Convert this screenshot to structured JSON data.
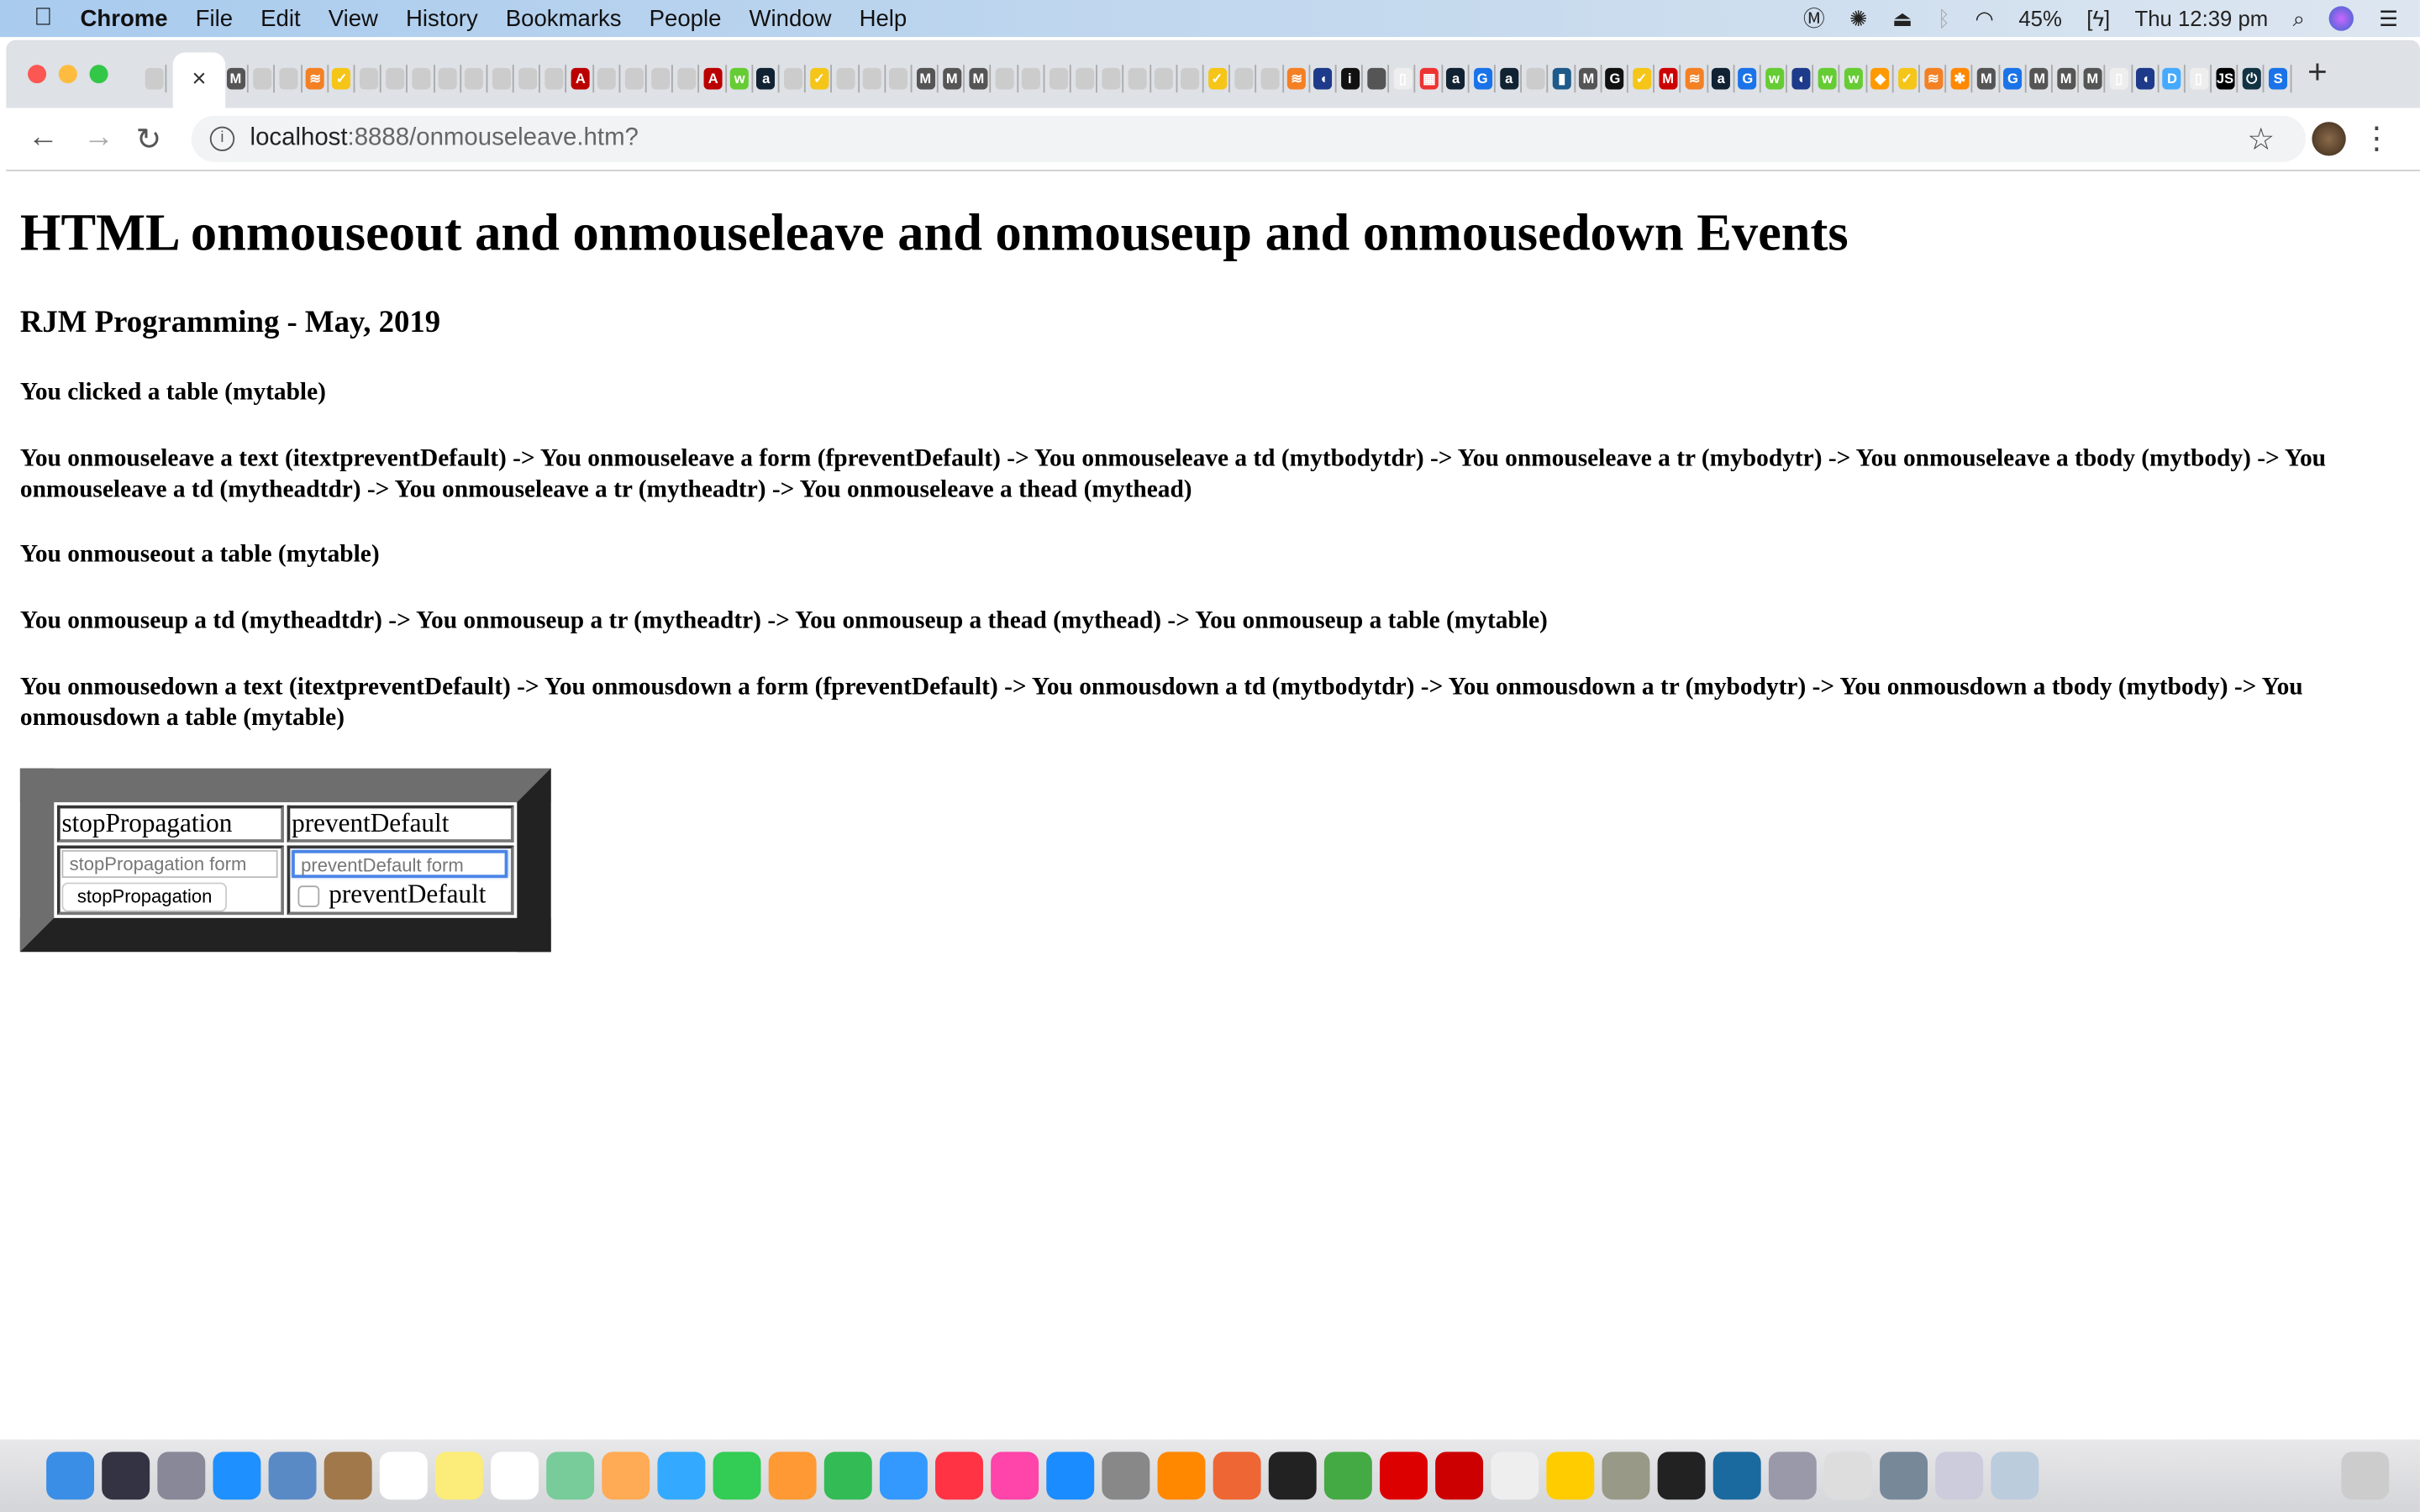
{
  "menubar": {
    "app": "Chrome",
    "items": [
      "File",
      "Edit",
      "View",
      "History",
      "Bookmarks",
      "People",
      "Window",
      "Help"
    ],
    "battery": "45%",
    "clock": "Thu 12:39 pm"
  },
  "tabs": {
    "close_glyph": "×",
    "new_tab_glyph": "+",
    "favicons": [
      [
        "#ccc",
        ""
      ],
      [
        "#555",
        "M"
      ],
      [
        "#ccc",
        ""
      ],
      [
        "#ccc",
        ""
      ],
      [
        "#f48024",
        "≋"
      ],
      [
        "#f5c518",
        "✓"
      ],
      [
        "#ccc",
        ""
      ],
      [
        "#ccc",
        ""
      ],
      [
        "#ccc",
        ""
      ],
      [
        "#ccc",
        ""
      ],
      [
        "#ccc",
        ""
      ],
      [
        "#ccc",
        ""
      ],
      [
        "#ccc",
        ""
      ],
      [
        "#ccc",
        ""
      ],
      [
        "#b00",
        "A"
      ],
      [
        "#ccc",
        ""
      ],
      [
        "#ccc",
        ""
      ],
      [
        "#ccc",
        ""
      ],
      [
        "#ccc",
        ""
      ],
      [
        "#b00",
        "A"
      ],
      [
        "#6c3",
        "w"
      ],
      [
        "#123",
        "a"
      ],
      [
        "#ccc",
        ""
      ],
      [
        "#f5c518",
        "✓"
      ],
      [
        "#ccc",
        ""
      ],
      [
        "#ccc",
        ""
      ],
      [
        "#ccc",
        ""
      ],
      [
        "#555",
        "M"
      ],
      [
        "#555",
        "M"
      ],
      [
        "#555",
        "M"
      ],
      [
        "#ccc",
        ""
      ],
      [
        "#ccc",
        ""
      ],
      [
        "#ccc",
        ""
      ],
      [
        "#ccc",
        ""
      ],
      [
        "#ccc",
        ""
      ],
      [
        "#ccc",
        ""
      ],
      [
        "#ccc",
        ""
      ],
      [
        "#ccc",
        ""
      ],
      [
        "#f5c518",
        "✓"
      ],
      [
        "#ccc",
        ""
      ],
      [
        "#ccc",
        ""
      ],
      [
        "#f48024",
        "≋"
      ],
      [
        "#1e3a8a",
        "◖"
      ],
      [
        "#111",
        "i"
      ],
      [
        "#555",
        ""
      ],
      [
        "#eee",
        "▯"
      ],
      [
        "#e33",
        "▦"
      ],
      [
        "#123",
        "a"
      ],
      [
        "#1a73e8",
        "G"
      ],
      [
        "#123",
        "a"
      ],
      [
        "#ccc",
        ""
      ],
      [
        "#1e5a8a",
        "▮"
      ],
      [
        "#555",
        "M"
      ],
      [
        "#111",
        "G"
      ],
      [
        "#f5c518",
        "✓"
      ],
      [
        "#c00",
        "M"
      ],
      [
        "#f48024",
        "≋"
      ],
      [
        "#123",
        "a"
      ],
      [
        "#1a73e8",
        "G"
      ],
      [
        "#6c3",
        "w"
      ],
      [
        "#1e3a8a",
        "◖"
      ],
      [
        "#6c3",
        "w"
      ],
      [
        "#6c3",
        "w"
      ],
      [
        "#f90",
        "◆"
      ],
      [
        "#f5c518",
        "✓"
      ],
      [
        "#f48024",
        "≋"
      ],
      [
        "#f80",
        "✱"
      ],
      [
        "#555",
        "M"
      ],
      [
        "#1a73e8",
        "G"
      ],
      [
        "#555",
        "M"
      ],
      [
        "#555",
        "M"
      ],
      [
        "#555",
        "M"
      ],
      [
        "#eee",
        "▯"
      ],
      [
        "#1e3a8a",
        "◖"
      ],
      [
        "#4af",
        "D"
      ],
      [
        "#eee",
        "▯"
      ],
      [
        "#000",
        "JS"
      ],
      [
        "#134",
        "⏻"
      ],
      [
        "#1a73e8",
        "S"
      ]
    ]
  },
  "address": {
    "host": "localhost",
    "path": ":8888/onmouseleave.htm?"
  },
  "page": {
    "title": "HTML onmouseout and onmouseleave and onmouseup and onmousedown Events",
    "subtitle": "RJM Programming - May, 2019",
    "messages": [
      "You clicked a table (mytable)",
      "You onmouseleave a text (itextpreventDefault) -> You onmouseleave a form (fpreventDefault) -> You onmouseleave a td (mytbodytdr) -> You onmouseleave a tr (mybodytr) -> You onmouseleave a tbody (mytbody) -> You onmouseleave a td (mytheadtdr) -> You onmouseleave a tr (mytheadtr) -> You onmouseleave a thead (mythead)",
      "You onmouseout a table (mytable)",
      "You onmouseup a td (mytheadtdr) -> You onmouseup a tr (mytheadtr) -> You onmouseup a thead (mythead) -> You onmouseup a table (mytable)",
      "You onmousedown a text (itextpreventDefault) -> You onmousdown a form (fpreventDefault) -> You onmousdown a td (mytbodytdr) -> You onmousdown a tr (mybodytr) -> You onmousdown a tbody (mytbody) -> You onmousdown a table (mytable)"
    ],
    "table": {
      "head_left": "stopPropagation",
      "head_right": "preventDefault",
      "left_input_placeholder": "stopPropagation form",
      "left_button": "stopPropagation",
      "right_input_placeholder": "preventDefault form",
      "right_checkbox_label": "preventDefault",
      "right_checkbox_checked": false
    }
  },
  "dock": {
    "icons": [
      "finder",
      "siri",
      "launchpad",
      "safari",
      "mail",
      "notefile",
      "calendar",
      "notes",
      "reminders",
      "maps",
      "photos",
      "messages",
      "facetime",
      "pages",
      "numbers",
      "keynote",
      "news",
      "music",
      "app-store",
      "system-preferences",
      "vlc",
      "firefox",
      "phpstorm",
      "chrome",
      "opera",
      "filezilla",
      "sequel",
      "cyberduck",
      "gimp",
      "terminal",
      "quicktime",
      "preview",
      "textedit",
      "folder",
      "documents",
      "downloads",
      "trash"
    ],
    "colors": [
      "#3a8ee6",
      "#334",
      "#889",
      "#1e90ff",
      "#5a8ac6",
      "#a0784a",
      "#fff",
      "#fcec7a",
      "#fff",
      "#7c9",
      "#fa5",
      "#3af",
      "#3c5",
      "#f93",
      "#3b5",
      "#39f",
      "#f34",
      "#f4a",
      "#1a8cff",
      "#888",
      "#f80",
      "#e63",
      "#222",
      "#4a4",
      "#d00",
      "#c00",
      "#eee",
      "#fc0",
      "#998",
      "#222",
      "#1a6aa0",
      "#99a",
      "#ddd",
      "#789",
      "#ccd",
      "#bcd",
      "#ccc"
    ]
  }
}
